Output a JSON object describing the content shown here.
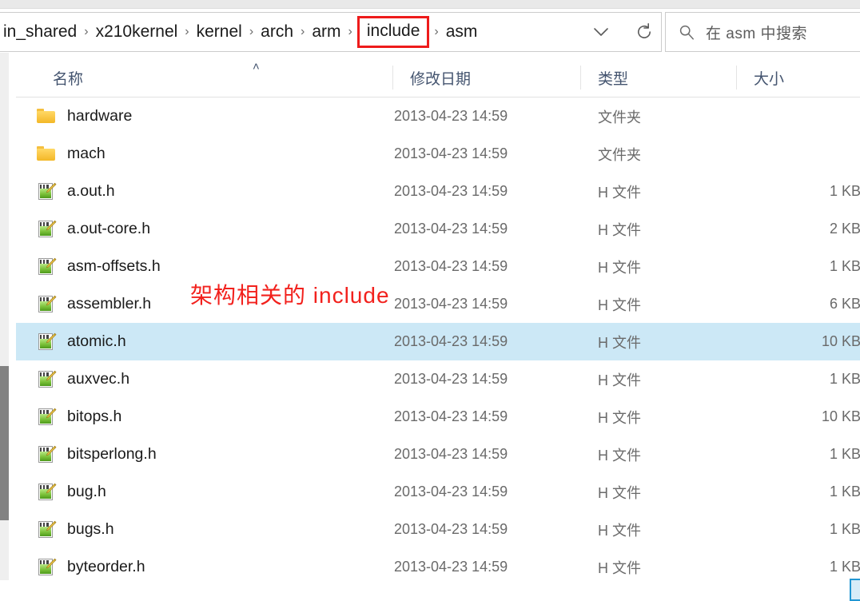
{
  "window": {
    "title": "asm"
  },
  "addressbar": {
    "breadcrumbs": [
      {
        "label": "in_shared",
        "highlighted": false
      },
      {
        "label": "x210kernel",
        "highlighted": false
      },
      {
        "label": "kernel",
        "highlighted": false
      },
      {
        "label": "arch",
        "highlighted": false
      },
      {
        "label": "arm",
        "highlighted": false
      },
      {
        "label": "include",
        "highlighted": true
      },
      {
        "label": "asm",
        "highlighted": false
      }
    ],
    "separator": "›",
    "history_dropdown_icon": "chevron-down-icon",
    "refresh_icon": "refresh-icon",
    "highlight_color": "#ee1b1b"
  },
  "search": {
    "icon": "search-icon",
    "placeholder": "在 asm 中搜索",
    "value": ""
  },
  "columns": {
    "name": "名称",
    "date": "修改日期",
    "type": "类型",
    "size": "大小",
    "sort_caret": "˄",
    "sorted_by": "名称",
    "sort_direction": "ascending"
  },
  "files": [
    {
      "name": "hardware",
      "icon": "folder-icon",
      "date": "2013-04-23 14:59",
      "type": "文件夹",
      "size": "",
      "selected": false
    },
    {
      "name": "mach",
      "icon": "folder-icon",
      "date": "2013-04-23 14:59",
      "type": "文件夹",
      "size": "",
      "selected": false
    },
    {
      "name": "a.out.h",
      "icon": "h-file-icon",
      "date": "2013-04-23 14:59",
      "type": "H 文件",
      "size": "1 KB",
      "selected": false
    },
    {
      "name": "a.out-core.h",
      "icon": "h-file-icon",
      "date": "2013-04-23 14:59",
      "type": "H 文件",
      "size": "2 KB",
      "selected": false
    },
    {
      "name": "asm-offsets.h",
      "icon": "h-file-icon",
      "date": "2013-04-23 14:59",
      "type": "H 文件",
      "size": "1 KB",
      "selected": false
    },
    {
      "name": "assembler.h",
      "icon": "h-file-icon",
      "date": "2013-04-23 14:59",
      "type": "H 文件",
      "size": "6 KB",
      "selected": false
    },
    {
      "name": "atomic.h",
      "icon": "h-file-icon",
      "date": "2013-04-23 14:59",
      "type": "H 文件",
      "size": "10 KB",
      "selected": true
    },
    {
      "name": "auxvec.h",
      "icon": "h-file-icon",
      "date": "2013-04-23 14:59",
      "type": "H 文件",
      "size": "1 KB",
      "selected": false
    },
    {
      "name": "bitops.h",
      "icon": "h-file-icon",
      "date": "2013-04-23 14:59",
      "type": "H 文件",
      "size": "10 KB",
      "selected": false
    },
    {
      "name": "bitsperlong.h",
      "icon": "h-file-icon",
      "date": "2013-04-23 14:59",
      "type": "H 文件",
      "size": "1 KB",
      "selected": false
    },
    {
      "name": "bug.h",
      "icon": "h-file-icon",
      "date": "2013-04-23 14:59",
      "type": "H 文件",
      "size": "1 KB",
      "selected": false
    },
    {
      "name": "bugs.h",
      "icon": "h-file-icon",
      "date": "2013-04-23 14:59",
      "type": "H 文件",
      "size": "1 KB",
      "selected": false
    },
    {
      "name": "byteorder.h",
      "icon": "h-file-icon",
      "date": "2013-04-23 14:59",
      "type": "H 文件",
      "size": "1 KB",
      "selected": false
    }
  ],
  "annotation": {
    "text": "架构相关的 include",
    "color": "#f2211d"
  },
  "selection": {
    "color": "#cce8f6"
  }
}
